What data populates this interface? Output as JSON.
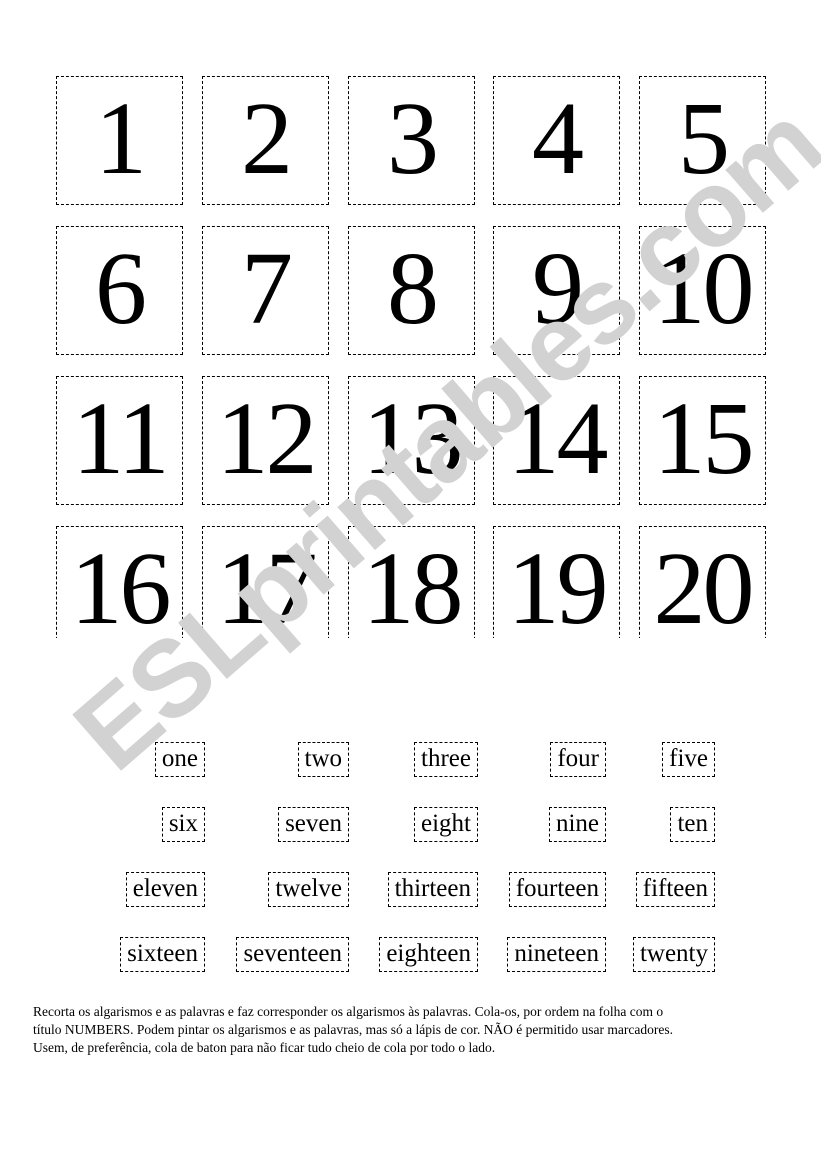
{
  "document": {
    "type": "printable-worksheet",
    "background_color": "#ffffff",
    "ink_color": "#000000"
  },
  "watermark": {
    "text": "ESLprintables.com",
    "color": "#d2d2d2",
    "rotation_deg": -41
  },
  "number_cards": {
    "rows": [
      [
        "1",
        "2",
        "3",
        "4",
        "5"
      ],
      [
        "6",
        "7",
        "8",
        "9",
        "10"
      ],
      [
        "11",
        "12",
        "13",
        "14",
        "15"
      ],
      [
        "16",
        "17",
        "18",
        "19",
        "20"
      ]
    ]
  },
  "word_cards": {
    "rows": [
      [
        "one",
        "two",
        "three",
        "four",
        "five"
      ],
      [
        "six",
        "seven",
        "eight",
        "nine",
        "ten"
      ],
      [
        "eleven",
        "twelve",
        "thirteen",
        "fourteen",
        "fifteen"
      ],
      [
        "sixteen",
        "seventeen",
        "eighteen",
        "nineteen",
        "twenty"
      ]
    ]
  },
  "instructions": {
    "line1": "Recorta os algarismos e as palavras e faz corresponder os algarismos às palavras. Cola-os, por ordem na folha com o",
    "line2": "título NUMBERS. Podem pintar os algarismos e as palavras, mas só a lápis de cor. NÃO é permitido usar marcadores.",
    "line3": "Usem, de preferência, cola de baton para não ficar tudo cheio de cola por todo o lado."
  }
}
